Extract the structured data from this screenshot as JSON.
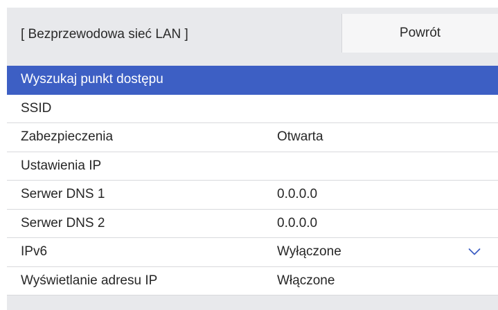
{
  "header": {
    "title": "[ Bezprzewodowa sieć LAN ]",
    "back_label": "Powrót"
  },
  "menu": {
    "items": [
      {
        "label": "Wyszukaj punkt dostępu",
        "value": "",
        "selected": true
      },
      {
        "label": "SSID",
        "value": ""
      },
      {
        "label": "Zabezpieczenia",
        "value": "Otwarta"
      },
      {
        "label": "Ustawienia IP",
        "value": ""
      },
      {
        "label": "Serwer DNS 1",
        "value": "0.0.0.0"
      },
      {
        "label": "Serwer DNS 2",
        "value": "0.0.0.0"
      },
      {
        "label": "IPv6",
        "value": "Wyłączone"
      },
      {
        "label": "Wyświetlanie adresu IP",
        "value": "Włączone"
      }
    ],
    "scroll_indicator_icon": "chevron-down-icon"
  },
  "colors": {
    "panel_background": "#e8e9ec",
    "selected_row": "#3d5fc4",
    "chevron": "#3d5fc4"
  }
}
